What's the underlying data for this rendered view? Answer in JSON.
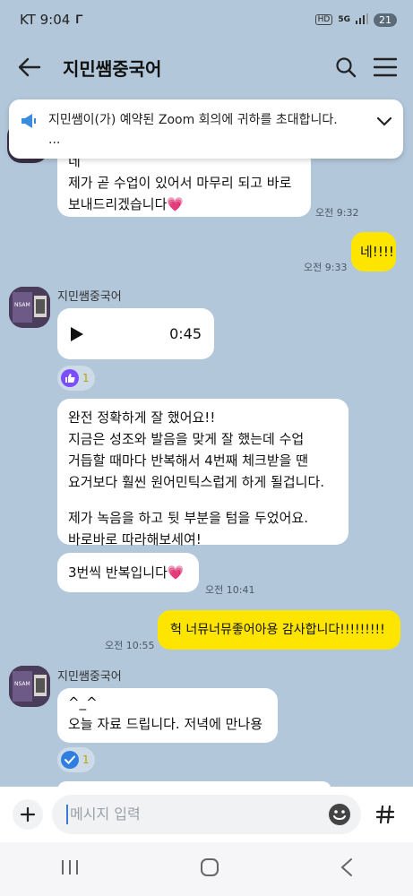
{
  "status": {
    "carrier_time": "KT 9:04",
    "battery": "21",
    "hd": "HD",
    "network": "5G"
  },
  "appbar": {
    "title": "지민쌤중국어"
  },
  "notice": {
    "text": "지민쌤이(가) 예약된 Zoom 회의에 귀하를 초대합니다.",
    "ellipsis": "..."
  },
  "messages": {
    "m1": {
      "line1": "네",
      "line2": "제가 곧 수업이 있어서 마무리 되고 바로",
      "line3": "보내드리겠습니다💗",
      "time": "오전 9:32"
    },
    "m2": {
      "text": "네!!!!",
      "time": "오전 9:33"
    },
    "sender1": "지민쌤중국어",
    "voice": {
      "duration": "0:45",
      "reaction_count": "1"
    },
    "m3": {
      "l1": "완전 정확하게 잘 했어요!!",
      "l2": "지금은 성조와 발음을 맞게 잘 했는데 수업",
      "l3": "거듭할 때마다 반복해서 4번째 체크받을 땐",
      "l4": "요거보다 훨씬 원어민틱스럽게 하게 될겁니다.",
      "l5": "제가 녹음을 하고 뒷 부분을 텀을 두었어요.",
      "l6": "바로바로 따라해보세여!"
    },
    "m4": {
      "text": "3번씩 반복입니다💗",
      "time": "오전 10:41"
    },
    "m5": {
      "text": "헉 너뮤너뮤좋어아용 감사합니다!!!!!!!!!",
      "time": "오전 10:55"
    },
    "sender2": "지민쌤중국어",
    "m6": {
      "l1": "^_^",
      "l2": "오늘 자료 드립니다. 저녁에 만나용",
      "reaction_count": "1"
    }
  },
  "input": {
    "placeholder": "메시지 입력"
  },
  "colors": {
    "background": "#b2c7da",
    "my_bubble": "#fee500",
    "other_bubble": "#ffffff"
  },
  "icons": [
    "back-arrow-icon",
    "search-icon",
    "menu-icon",
    "megaphone-icon",
    "chevron-down-icon",
    "play-icon",
    "thumbs-up-icon",
    "check-icon",
    "plus-icon",
    "emoji-icon",
    "hash-icon",
    "recent-apps-icon",
    "home-icon",
    "back-icon"
  ]
}
